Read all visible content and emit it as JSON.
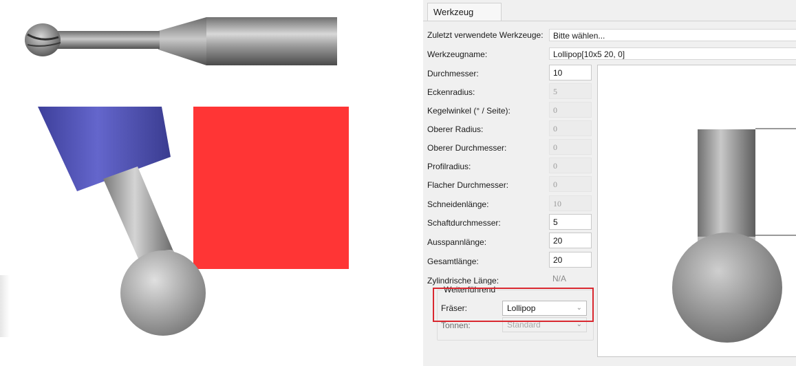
{
  "dialog": {
    "tab_label": "Werkzeug",
    "recent_tools": {
      "label": "Zuletzt verwendete Werkzeuge:",
      "value": "Bitte wählen..."
    },
    "tool_name": {
      "label": "Werkzeugname:",
      "value": "Lollipop[10x5 20, 0]"
    },
    "fields": [
      {
        "label": "Durchmesser:",
        "value": "10",
        "state": "editable"
      },
      {
        "label": "Eckenradius:",
        "value": "5",
        "state": "disabled"
      },
      {
        "label": "Kegelwinkel (° / Seite):",
        "value": "0",
        "state": "disabled"
      },
      {
        "label": "Oberer Radius:",
        "value": "0",
        "state": "disabled"
      },
      {
        "label": "Oberer Durchmesser:",
        "value": "0",
        "state": "disabled"
      },
      {
        "label": "Profilradius:",
        "value": "0",
        "state": "disabled"
      },
      {
        "label": "Flacher Durchmesser:",
        "value": "0",
        "state": "disabled"
      },
      {
        "label": "Schneidenlänge:",
        "value": "10",
        "state": "disabled"
      },
      {
        "label": "Schaftdurchmesser:",
        "value": "5",
        "state": "editable"
      },
      {
        "label": "Ausspannlänge:",
        "value": "20",
        "state": "editable"
      },
      {
        "label": "Gesamtlänge:",
        "value": "20",
        "state": "editable"
      },
      {
        "label": "Zylindrische Länge:",
        "value": "N/A",
        "state": "na"
      }
    ],
    "advanced": {
      "title": "Weiterführend",
      "cutter": {
        "label": "Fräser:",
        "value": "Lollipop",
        "enabled": true
      },
      "barrel": {
        "label": "Tonnen:",
        "value": "Standard",
        "enabled": false
      }
    }
  },
  "colors": {
    "highlight_box": "#d9272f",
    "stock_block": "#ff3535",
    "holder": "#5658c0"
  },
  "icons": {
    "dropdown": "chevron-down-icon"
  }
}
